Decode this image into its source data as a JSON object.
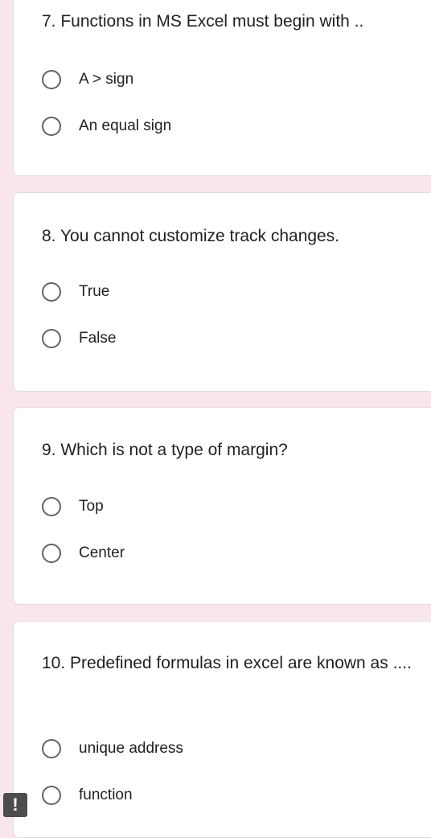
{
  "questions": [
    {
      "title": "7. Functions in MS Excel must begin with ..",
      "options": [
        "A > sign",
        "An equal sign"
      ]
    },
    {
      "title": "8. You cannot customize track changes.",
      "options": [
        "True",
        "False"
      ]
    },
    {
      "title": "9. Which is not a type of margin?",
      "options": [
        "Top",
        "Center"
      ]
    },
    {
      "title": "10. Predefined formulas in excel are known as ....",
      "options": [
        "unique address",
        "function"
      ]
    }
  ],
  "report_button": {
    "icon": "exclamation-icon",
    "glyph": "!"
  },
  "colors": {
    "background": "#f8e6ec",
    "card": "#ffffff",
    "text": "#202124",
    "radio_border": "#5f6368"
  }
}
